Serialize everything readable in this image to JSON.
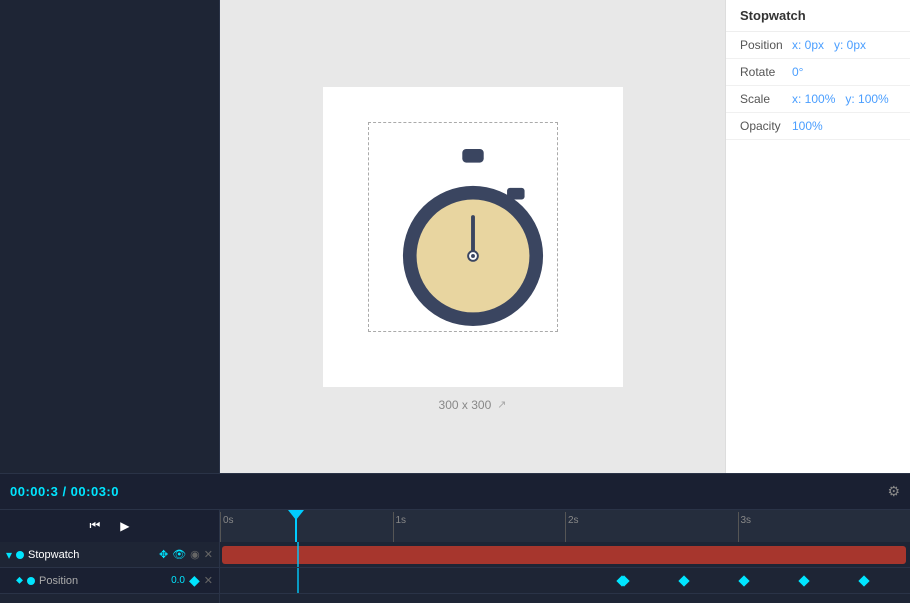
{
  "rightPanel": {
    "title": "Stopwatch",
    "position": {
      "label": "Position",
      "x": "x: 0px",
      "y": "y: 0px"
    },
    "rotate": {
      "label": "Rotate",
      "value": "0°"
    },
    "scale": {
      "label": "Scale",
      "x": "x: 100%",
      "y": "y: 100%"
    },
    "opacity": {
      "label": "Opacity",
      "value": "100%"
    }
  },
  "canvas": {
    "size": "300 x 300"
  },
  "timeline": {
    "currentTime": "00:00:3",
    "totalTime": "00:03:0",
    "rulers": [
      "0s",
      "1s",
      "2s",
      "3s"
    ]
  },
  "tracks": [
    {
      "name": "Stopwatch",
      "dot": true,
      "move": true,
      "visible": true,
      "close": true
    }
  ],
  "subTracks": [
    {
      "name": "Position",
      "value": "0.0"
    }
  ],
  "buttons": {
    "rewind": "⏮",
    "play": "▶",
    "settingsIcon": "⚙",
    "resize": "↗"
  }
}
